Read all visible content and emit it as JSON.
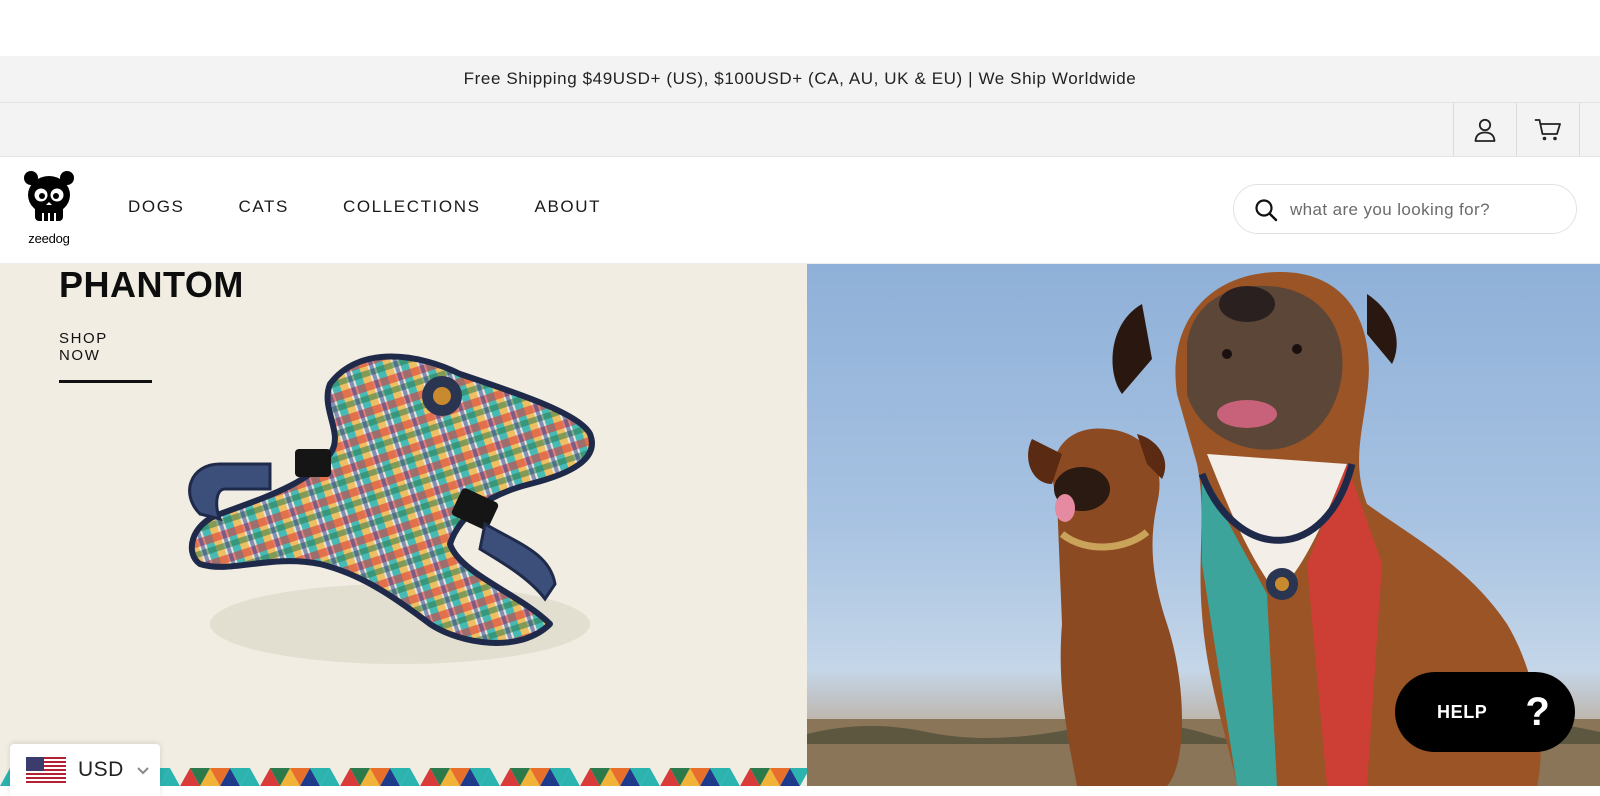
{
  "announcement": "Free Shipping $49USD+ (US), $100USD+ (CA, AU, UK & EU) | We Ship Worldwide",
  "utility": {
    "account_icon": "user-icon",
    "cart_icon": "cart-icon"
  },
  "brand": {
    "logo_text": "zeedog",
    "logo_icon": "skull-icon"
  },
  "nav": {
    "items": [
      {
        "label": "DOGS"
      },
      {
        "label": "CATS"
      },
      {
        "label": "COLLECTIONS"
      },
      {
        "label": "ABOUT"
      }
    ]
  },
  "search": {
    "placeholder": "what are you looking for?",
    "icon": "search-icon"
  },
  "hero": {
    "title": "PHANTOM",
    "cta_label": "SHOP NOW"
  },
  "help": {
    "label": "HELP",
    "glyph": "?"
  },
  "currency": {
    "code": "USD",
    "flag": "us-flag-icon"
  },
  "colors": {
    "hero_left_bg": "#f1ede2",
    "sky": "#a8c3e2",
    "help_bg": "#000000",
    "announce_bg": "#f3f3f3"
  }
}
